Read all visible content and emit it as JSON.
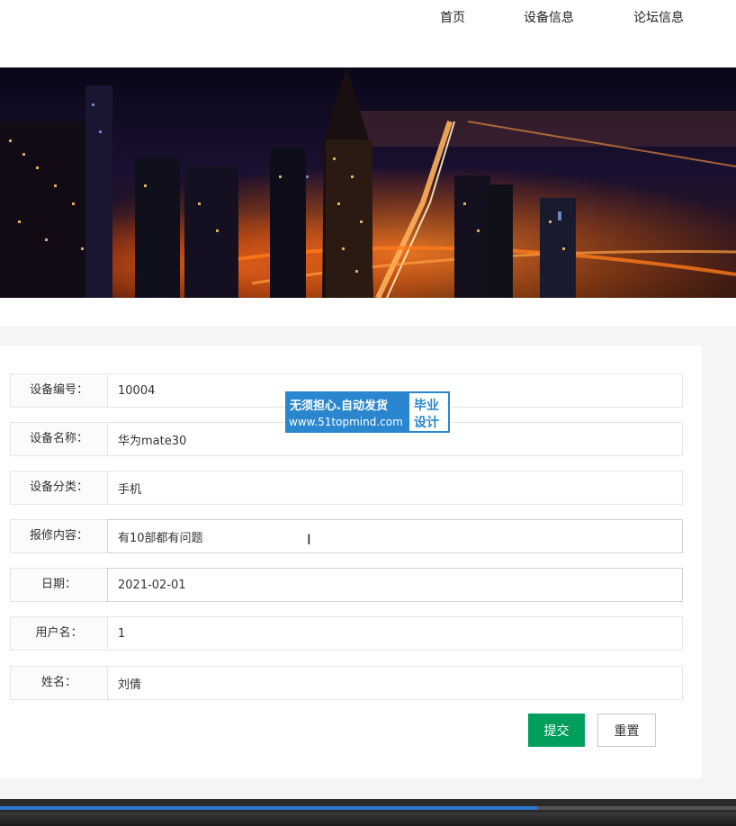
{
  "nav": {
    "home": "首页",
    "device_info": "设备信息",
    "forum_info": "论坛信息"
  },
  "form": {
    "rows": [
      {
        "label": "设备编号：",
        "value": "10004"
      },
      {
        "label": "设备名称：",
        "value": "华为mate30"
      },
      {
        "label": "设备分类：",
        "value": "手机"
      },
      {
        "label": "报修内容：",
        "value": "有10部都有问题"
      },
      {
        "label": "日期：",
        "value": "2021-02-01"
      },
      {
        "label": "用户名：",
        "value": "1"
      },
      {
        "label": "姓名：",
        "value": "刘倩"
      }
    ],
    "submit_label": "提交",
    "reset_label": "重置"
  },
  "watermark": {
    "line1": "无须担心.自动发货",
    "line2": "www.51topmind.com",
    "right1": "毕业",
    "right2": "设计"
  },
  "video_progress": 0.73,
  "colors": {
    "accent": "#009f5d",
    "watermark_blue": "#2a86cf"
  }
}
